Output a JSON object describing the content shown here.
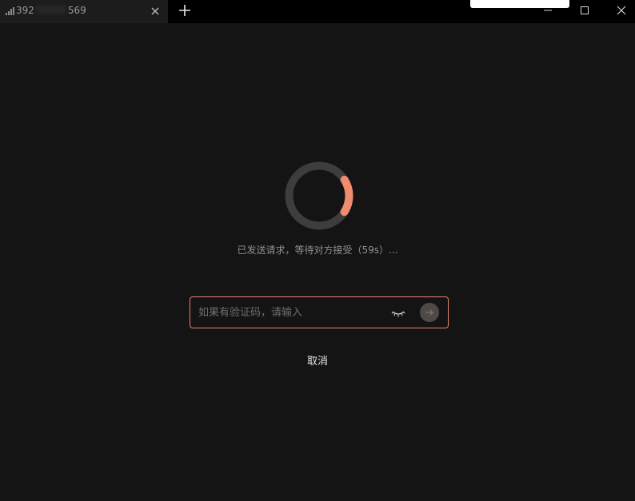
{
  "tab": {
    "label_start": "392",
    "label_end": "569",
    "signal_icon": "signal-bars-icon",
    "close_icon": "close-icon"
  },
  "toolbar": {
    "new_tab_icon": "plus-icon"
  },
  "window_controls": [
    "minimize-icon",
    "maximize-icon",
    "close-icon"
  ],
  "waiting": {
    "spinner_icon": "loading-ring-icon",
    "progress_fraction": 0.18,
    "status_text": "已发送请求，等待对方接受（59s）..."
  },
  "code_input": {
    "placeholder": "如果有验证码，请输入",
    "value": "",
    "visibility_icon": "eye-closed-icon",
    "submit_icon": "arrow-right-icon"
  },
  "actions": {
    "cancel_label": "取消"
  },
  "colors": {
    "background": "#141414",
    "titlebar": "#000000",
    "tab_active": "#1c1c1c",
    "accent": "#f08c6e",
    "input_border": "#e9836a",
    "spinner_track": "#3d3d3d"
  }
}
